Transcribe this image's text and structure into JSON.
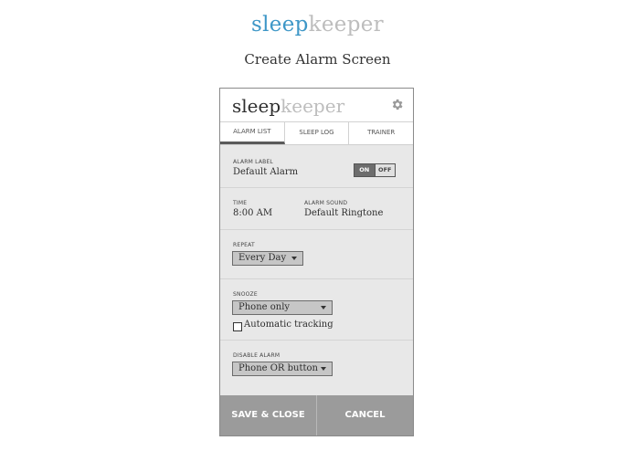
{
  "header": {
    "brand_part1": "sleep",
    "brand_part2": "keeper",
    "screen_title": "Create Alarm Screen"
  },
  "app": {
    "logo_part1": "sleep",
    "logo_part2": "keeper",
    "settings_icon": "gear-icon",
    "tabs": [
      {
        "label": "ALARM LIST",
        "active": true
      },
      {
        "label": "SLEEP LOG",
        "active": false
      },
      {
        "label": "TRAINER",
        "active": false
      }
    ]
  },
  "form": {
    "alarm_label": {
      "label": "ALARM LABEL",
      "value": "Default Alarm"
    },
    "toggle": {
      "on": "ON",
      "off": "OFF",
      "state": "ON"
    },
    "time": {
      "label": "TIME",
      "value": "8:00 AM"
    },
    "alarm_sound": {
      "label": "ALARM SOUND",
      "value": "Default Ringtone"
    },
    "repeat": {
      "label": "REPEAT",
      "value": "Every Day"
    },
    "snooze": {
      "label": "SNOOZE",
      "value": "Phone only"
    },
    "auto_tracking": {
      "label": "Automatic tracking",
      "checked": false
    },
    "disable_alarm": {
      "label": "DISABLE ALARM",
      "value": "Phone OR button"
    }
  },
  "footer": {
    "save_label": "SAVE & CLOSE",
    "cancel_label": "CANCEL"
  },
  "colors": {
    "brand_blue": "#3e97c7",
    "brand_gray": "#bdbdbd",
    "footer_bg": "#9b9b9b"
  }
}
